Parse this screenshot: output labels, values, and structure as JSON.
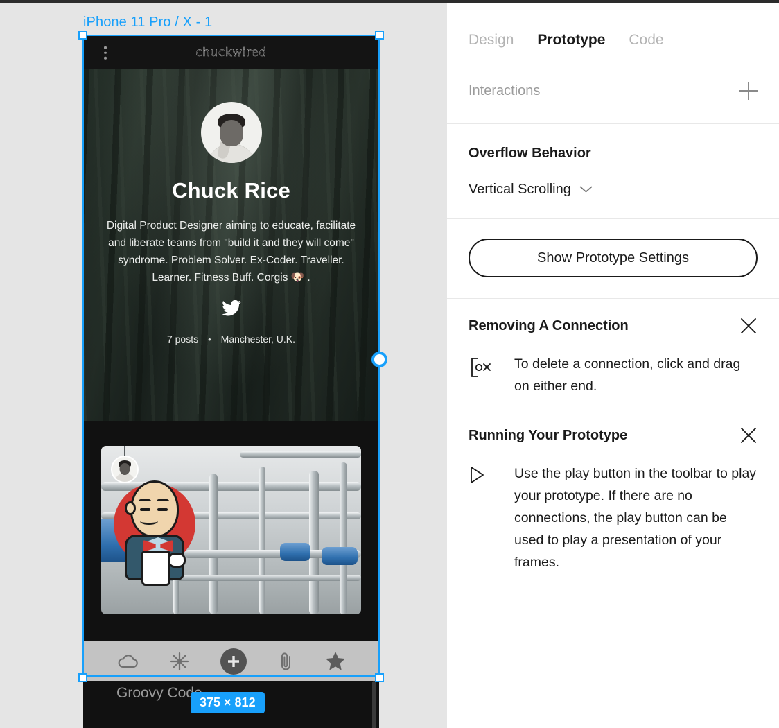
{
  "canvas": {
    "frame_label": "iPhone 11 Pro / X - 1",
    "size_badge": "375 × 812",
    "next_frame_title": "Groovy Code"
  },
  "phone": {
    "brand": "chuckwired",
    "menu_icon": "kebab-menu-icon",
    "profile": {
      "name": "Chuck Rice",
      "bio": "Digital Product Designer aiming to educate, facilitate and liberate teams from \"build it and they will come\" syndrome. Problem Solver. Ex-Coder. Traveller. Learner. Fitness Buff. Corgis 🐶 .",
      "social_icon": "twitter-icon",
      "posts": "7 posts",
      "separator": "•",
      "location": "Manchester, U.K."
    },
    "post": {
      "avatar_icon": "post-author-avatar",
      "image_icon": "jenkins-mascot-photo"
    },
    "nav": [
      {
        "name": "cloud-icon",
        "label": "Cloud"
      },
      {
        "name": "asterisk-icon",
        "label": "Sparkle"
      },
      {
        "name": "plus-icon",
        "label": "Add"
      },
      {
        "name": "paperclip-icon",
        "label": "Attach"
      },
      {
        "name": "star-icon",
        "label": "Favourites"
      }
    ]
  },
  "panel": {
    "tabs": [
      {
        "label": "Design",
        "active": false
      },
      {
        "label": "Prototype",
        "active": true
      },
      {
        "label": "Code",
        "active": false
      }
    ],
    "interactions": {
      "title": "Interactions",
      "add_icon": "plus-icon"
    },
    "overflow": {
      "heading": "Overflow Behavior",
      "value": "Vertical Scrolling",
      "chevron_icon": "chevron-down-icon"
    },
    "settings_button": "Show Prototype Settings",
    "tips": [
      {
        "title": "Removing A Connection",
        "text": "To delete a connection, click and drag on either end.",
        "icon": "remove-connection-icon",
        "close_icon": "close-icon"
      },
      {
        "title": "Running Your Prototype",
        "text": "Use the play button in the toolbar to play your prototype. If there are no connections, the play button can be used to play a presentation of your frames.",
        "icon": "play-icon",
        "close_icon": "close-icon"
      }
    ]
  },
  "colors": {
    "figma_blue": "#18a0fb",
    "canvas_bg": "#e5e5e5",
    "panel_bg": "#ffffff",
    "phone_bg": "#111111"
  }
}
